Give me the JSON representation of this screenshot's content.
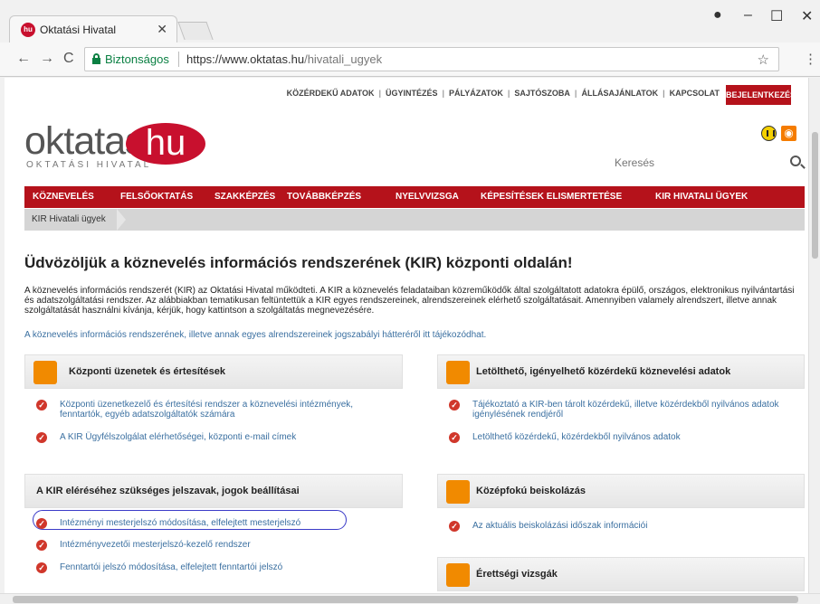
{
  "browser": {
    "tab_title": "Oktatási Hivatal",
    "tab_favicon": "hu",
    "secure_label": "Biztonságos",
    "url_base": "https://www.oktatas.hu",
    "url_path": "/hivatali_ugyek"
  },
  "header": {
    "topnav": [
      "KÖZÉRDEKŰ ADATOK",
      "ÜGYINTÉZÉS",
      "PÁLYÁZATOK",
      "SAJTÓSZOBA",
      "ÁLLÁSAJÁNLATOK",
      "KAPCSOLAT"
    ],
    "login": "BEJELENTKEZÉS",
    "logo_main": "oktatas",
    "logo_hu": "hu",
    "logo_sub": "OKTATÁSI HIVATAL",
    "search_placeholder": "Keresés"
  },
  "mainnav": [
    "KÖZNEVELÉS",
    "FELSŐOKTATÁS",
    "SZAKKÉPZÉS",
    "TOVÁBBKÉPZÉS",
    "NYELVVIZSGA",
    "KÉPESÍTÉSEK ELISMERTETÉSE",
    "KIR HIVATALI ÜGYEK"
  ],
  "breadcrumb": "KIR Hivatali ügyek",
  "content": {
    "title": "Üdvözöljük a köznevelés információs rendszerének (KIR) központi oldalán!",
    "intro": "A köznevelés információs rendszerét (KIR) az Oktatási Hivatal működteti. A KIR a köznevelés feladataiban közreműködők által szolgáltatott adatokra épülő, országos, elektronikus nyilvántartási és adatszolgáltatási rendszer. Az alábbiakban tematikusan feltüntettük a KIR egyes rendszereinek, alrendszereinek elérhető szolgáltatásait. Amennyiben valamely alrendszert, illetve annak szolgáltatását használni kívánja, kérjük, hogy kattintson a szolgáltatás megnevezésére.",
    "legal_link": "A köznevelés információs rendszerének, illetve annak egyes alrendszereinek jogszabályi hátteréről itt tájékozódhat."
  },
  "cards": {
    "c1_title": "Központi üzenetek és értesítések",
    "c1_item1": "Központi üzenetkezelő és értesítési rendszer a köznevelési intézmények, fenntartók, egyéb adatszolgáltatók számára",
    "c1_item2": "A KIR Ügyfélszolgálat elérhetőségei, központi e-mail címek",
    "c2_title": "Letölthető, igényelhető közérdekű köznevelési adatok",
    "c2_item1": "Tájékoztató a KIR-ben tárolt közérdekű, illetve közérdekből nyilvános adatok igénylésének rendjéről",
    "c2_item2": "Letölthető közérdekű, közérdekből nyilvános adatok",
    "c3_title": "A KIR eléréséhez szükséges jelszavak, jogok beállításai",
    "c3_item1": "Intézményi mesterjelszó módosítása, elfelejtett mesterjelszó",
    "c3_item2": "Intézményvezetői mesterjelszó-kezelő rendszer",
    "c3_item3": "Fenntartói jelszó módosítása, elfelejtett fenntartói jelszó",
    "c4_title": "Középfokú beiskolázás",
    "c4_item1": "Az aktuális beiskolázási időszak információi",
    "c5_title": "Érettségi vizsgák"
  },
  "colors": {
    "brand_red": "#b5121b",
    "link_blue": "#3a6fa0",
    "card_icon_orange": "#f18a00"
  }
}
